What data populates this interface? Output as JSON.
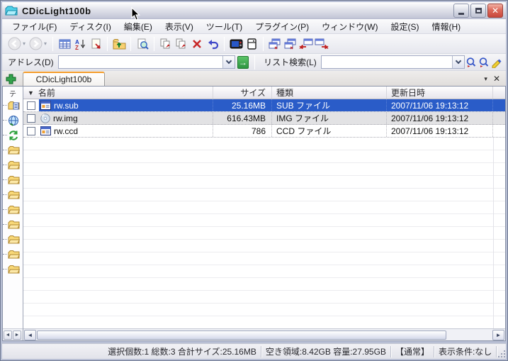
{
  "window": {
    "title": "CDicLight100b"
  },
  "glyphs": {
    "close_x": "✕",
    "small_triangle_down": "▾",
    "arrow_left": "◄",
    "arrow_right": "►",
    "go_arrow": "→"
  },
  "menu": {
    "items": [
      "ファイル(F)",
      "ディスク(I)",
      "編集(E)",
      "表示(V)",
      "ツール(T)",
      "プラグイン(P)",
      "ウィンドウ(W)",
      "設定(S)",
      "情報(H)"
    ]
  },
  "toolbar": {
    "icons": [
      "back",
      "forward",
      "list-view",
      "sort-az",
      "edit-new",
      "folder-up",
      "search-file",
      "copy-add",
      "copy-add-alt",
      "delete",
      "undo",
      "console",
      "drive",
      "cascade-windows",
      "cascade-windows-alt",
      "close-tab-left",
      "close-tab-right"
    ]
  },
  "addressbar": {
    "address_label": "アドレス(D)",
    "address_value": "",
    "search_label": "リスト検索(L)",
    "search_value": ""
  },
  "tabs": {
    "active": "CDicLight100b"
  },
  "sidebar": {
    "vertical_label": "テ",
    "icons": [
      "folder-doc",
      "network-globe",
      "sync-green",
      "folder",
      "folder",
      "folder",
      "folder",
      "folder",
      "folder",
      "folder",
      "folder",
      "folder"
    ]
  },
  "list": {
    "sort_indicator": "▼",
    "columns": {
      "name": "名前",
      "size": "サイズ",
      "type": "種類",
      "modified": "更新日時"
    },
    "rows": [
      {
        "name": "rw.sub",
        "size": "25.16MB",
        "type": "SUB ファイル",
        "modified": "2007/11/06 19:13:12",
        "selected": true,
        "icon": "window-file-icon"
      },
      {
        "name": "rw.img",
        "size": "616.43MB",
        "type": "IMG ファイル",
        "modified": "2007/11/06 19:13:12",
        "selected": false,
        "icon": "disc-icon"
      },
      {
        "name": "rw.ccd",
        "size": "786",
        "type": "CCD ファイル",
        "modified": "2007/11/06 19:13:12",
        "selected": false,
        "icon": "window-file-icon"
      }
    ]
  },
  "statusbar": {
    "selection": "選択個数:1 総数:3 合計サイズ:25.16MB",
    "capacity": "空き領域:8.42GB 容量:27.95GB",
    "mode": "【通常】",
    "filter": "表示条件:なし"
  },
  "colors": {
    "selection_blue": "#2a5cc8",
    "tab_accent_orange": "#f49c2a",
    "close_button_red": "#c8473c",
    "frame_silver": "#b8bfd4"
  }
}
